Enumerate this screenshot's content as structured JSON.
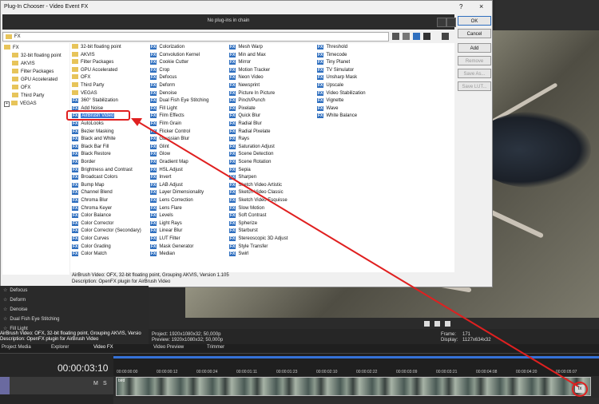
{
  "dialog": {
    "title": "Plug-In Chooser - Video Event FX",
    "help_glyph": "?",
    "close_glyph": "×",
    "chain_text": "No plug-ins in chain",
    "path_value": "FX"
  },
  "buttons": {
    "ok": "OK",
    "cancel": "Cancel",
    "add": "Add",
    "remove": "Remove",
    "save_as": "Save As...",
    "save_lut": "Save LUT..."
  },
  "tree": [
    {
      "label": "FX",
      "level": 0
    },
    {
      "label": "32-bit floating point",
      "level": 1
    },
    {
      "label": "AKVIS",
      "level": 1
    },
    {
      "label": "Filter Packages",
      "level": 1
    },
    {
      "label": "GPU Accelerated",
      "level": 1
    },
    {
      "label": "OFX",
      "level": 1
    },
    {
      "label": "Third Party",
      "level": 1
    },
    {
      "label": "VEGAS",
      "level": 1,
      "expander": "+"
    }
  ],
  "list": {
    "col1": [
      {
        "label": "32-bit floating point",
        "folder": true
      },
      {
        "label": "AKVIS",
        "folder": true
      },
      {
        "label": "Filter Packages",
        "folder": true
      },
      {
        "label": "GPU Accelerated",
        "folder": true
      },
      {
        "label": "OFX",
        "folder": true
      },
      {
        "label": "Third Party",
        "folder": true
      },
      {
        "label": "VEGAS",
        "folder": true
      },
      {
        "label": "360° Stabilization"
      },
      {
        "label": "Add Noise"
      },
      {
        "label": "AirBrush Video",
        "selected": true
      },
      {
        "label": "AutoLooks"
      },
      {
        "label": "Bezier Masking"
      },
      {
        "label": "Black and White"
      },
      {
        "label": "Black Bar Fill"
      },
      {
        "label": "Black Restore"
      },
      {
        "label": "Border"
      },
      {
        "label": "Brightness and Contrast"
      },
      {
        "label": "Broadcast Colors"
      },
      {
        "label": "Bump Map"
      },
      {
        "label": "Channel Blend"
      },
      {
        "label": "Chroma Blur"
      },
      {
        "label": "Chroma Keyer"
      },
      {
        "label": "Color Balance"
      },
      {
        "label": "Color Corrector"
      },
      {
        "label": "Color Corrector (Secondary)"
      },
      {
        "label": "Color Curves"
      },
      {
        "label": "Color Grading"
      },
      {
        "label": "Color Match"
      }
    ],
    "col2": [
      "Colorization",
      "Convolution Kernel",
      "Cookie Cutter",
      "Crop",
      "Defocus",
      "Deform",
      "Denoise",
      "Dual Fish Eye Stitching",
      "Fill Light",
      "Film Effects",
      "Film Grain",
      "Flicker Control",
      "Gaussian Blur",
      "Glint",
      "Glow",
      "Gradient Map",
      "HSL Adjust",
      "Invert",
      "LAB Adjust",
      "Layer Dimensionality",
      "Lens Correction",
      "Lens Flare",
      "Levels",
      "Light Rays",
      "Linear Blur",
      "LUT Filter",
      "Mask Generator",
      "Median"
    ],
    "col3": [
      "Mesh Warp",
      "Min and Max",
      "Mirror",
      "Motion Tracker",
      "Neon Video",
      "Newsprint",
      "Picture In Picture",
      "Pinch/Punch",
      "Pixelate",
      "Quick Blur",
      "Radial Blur",
      "Radial Pixelate",
      "Rays",
      "Saturation Adjust",
      "Scene Detection",
      "Scene Rotation",
      "Sepia",
      "Sharpen",
      "Sketch Video Artistic",
      "Sketch Video Classic",
      "Sketch Video Esquisse",
      "Slow Motion",
      "Soft Contrast",
      "Spherize",
      "Starburst",
      "Stereoscopic 3D Adjust",
      "Style Transfer",
      "Swirl"
    ],
    "col4": [
      "Threshold",
      "Timecode",
      "Tiny Planet",
      "TV Simulator",
      "Unsharp Mask",
      "Upscale",
      "Video Stabilization",
      "Vignette",
      "Wave",
      "White Balance"
    ],
    "badge": "FX"
  },
  "description": {
    "line1": "AirBrush Video: OFX, 32-bit floating point, Grouping AKVIS, Version 1.105",
    "line2": "Description: OpenFX plugin for AirBrush Video"
  },
  "fx_panel": {
    "items": [
      "Defocus",
      "Deform",
      "Denoise",
      "Dual Fish Eye Stitching",
      "Fill Light"
    ],
    "status1": "AirBrush Video: OFX, 32-bit floating point, Grouping AKVIS, Versio",
    "status2": "Description: OpenFX plugin for AirBrush Video"
  },
  "preview_info": {
    "project": "Project:  1920x1080x32; 50,000p",
    "preview": "Preview:  1920x1080x32; 50,000p",
    "frame_label": "Frame:",
    "frame_value": "171",
    "display_label": "Display:",
    "display_value": "1127x634x32"
  },
  "tabs": [
    "Project Media",
    "Explorer",
    "Video FX",
    "Video Preview",
    "Trimmer"
  ],
  "timeline": {
    "timecode": "00:00:03:10",
    "track_buttons": [
      "M",
      "S"
    ],
    "ticks": [
      "00:00:00:00",
      "00:00:00:12",
      "00:00:00:24",
      "00:00:01:11",
      "00:00:01:23",
      "00:00:02:10",
      "00:00:02:22",
      "00:00:03:09",
      "00:00:03:21",
      "00:00:04:08",
      "00:00:04:20",
      "00:00:05:07"
    ],
    "clip_label": "bird",
    "fx_button": "fx"
  },
  "colors": {
    "accent_blue": "#3572d8",
    "annotation_red": "#e02020",
    "fx_badge": "#2f6fbf"
  }
}
